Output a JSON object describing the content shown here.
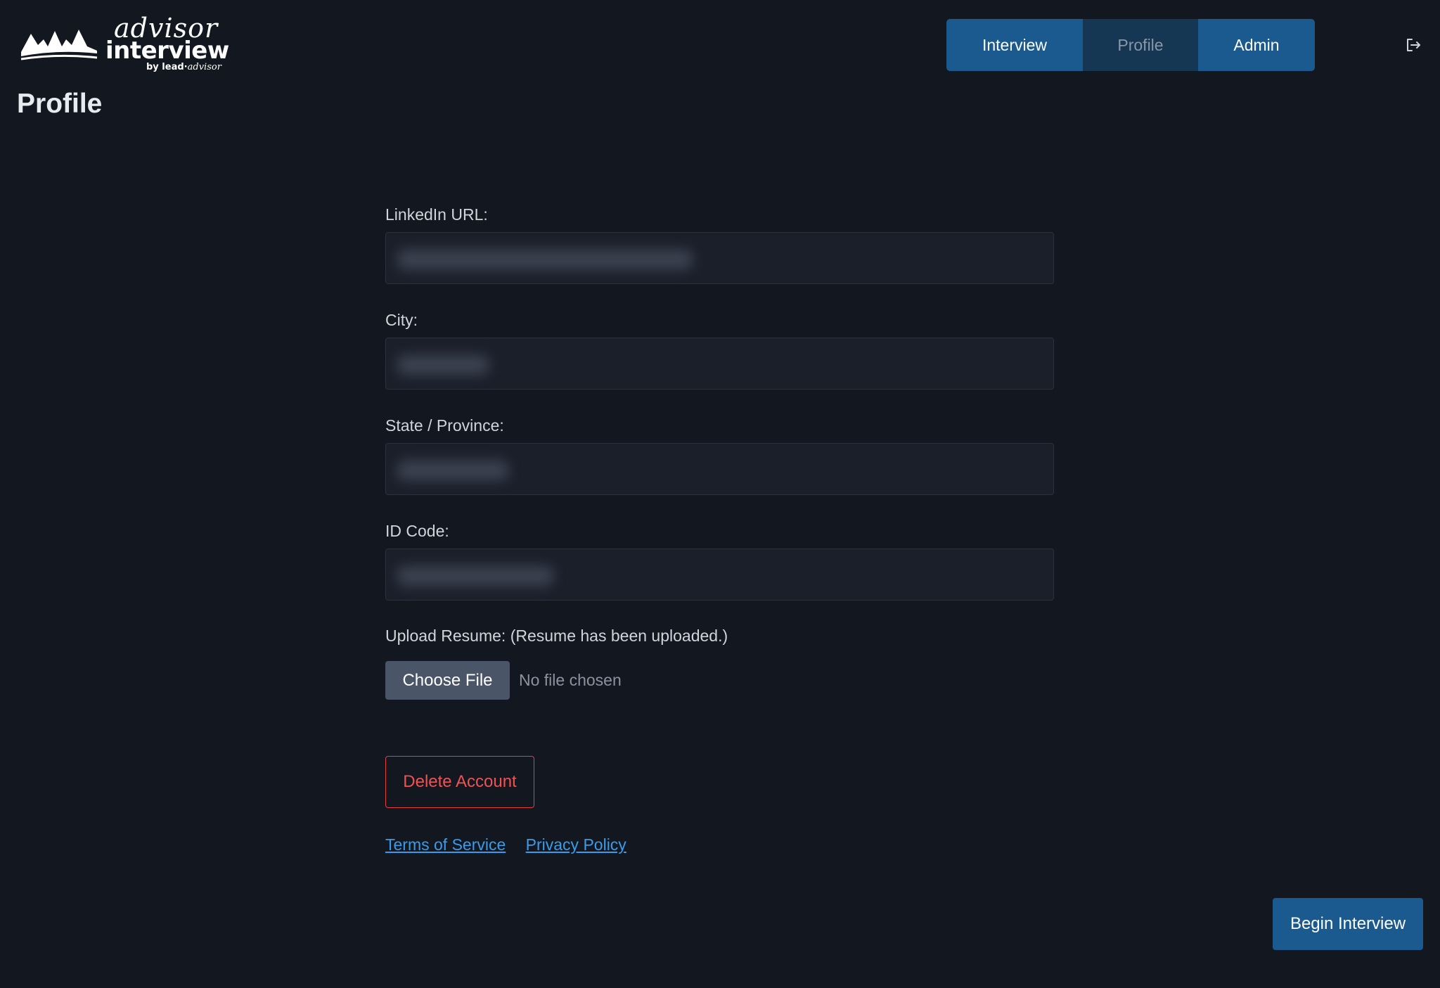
{
  "brand": {
    "script": "advisor",
    "word": "interview",
    "by_prefix": "by lead",
    "by_suffix": "advisor"
  },
  "nav": {
    "tabs": [
      {
        "label": "Interview",
        "active": false
      },
      {
        "label": "Profile",
        "active": true
      },
      {
        "label": "Admin",
        "active": false
      }
    ]
  },
  "page": {
    "title": "Profile"
  },
  "form": {
    "linkedin_label": "LinkedIn URL:",
    "city_label": "City:",
    "state_label": "State / Province:",
    "id_label": "ID Code:",
    "upload_label": "Upload Resume: (Resume has been uploaded.)",
    "choose_file": "Choose File",
    "no_file": "No file chosen"
  },
  "actions": {
    "delete_account": "Delete Account",
    "begin_interview": "Begin Interview"
  },
  "footer_links": {
    "terms": "Terms of Service",
    "privacy": "Privacy Policy"
  },
  "colors": {
    "background": "#121720",
    "nav_active_bg": "#163754",
    "primary": "#1a5a8e",
    "danger": "#e53e3e",
    "link": "#3b9be8"
  }
}
